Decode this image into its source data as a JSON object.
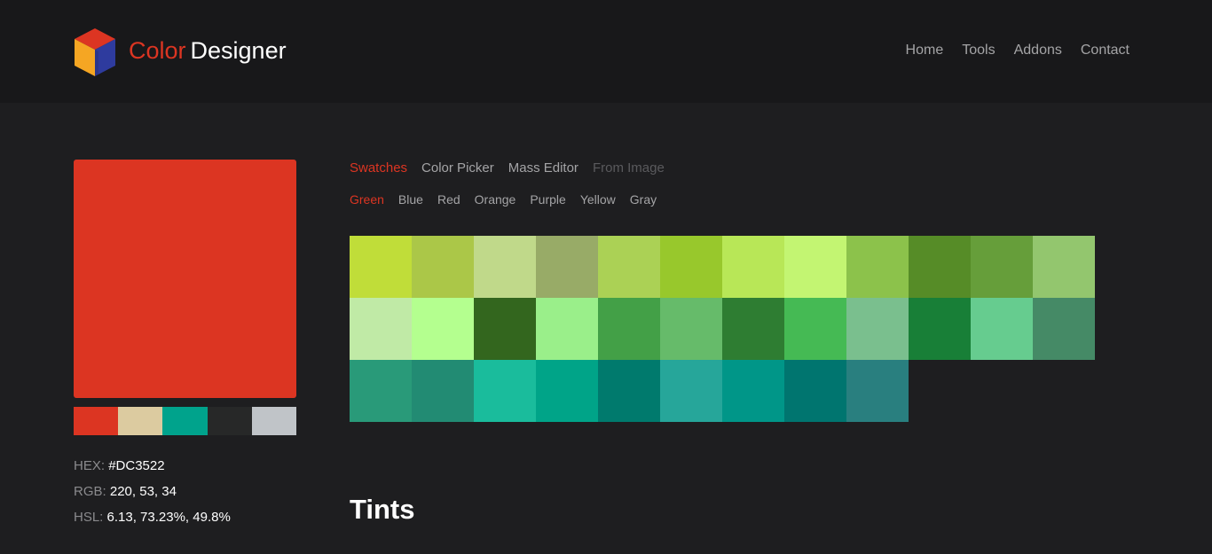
{
  "header": {
    "brand_part1": "Color",
    "brand_part2": "Designer",
    "nav": [
      "Home",
      "Tools",
      "Addons",
      "Contact"
    ]
  },
  "selected": {
    "color": "#DC3522",
    "palette": [
      "#DC3522",
      "#DCCBA0",
      "#00A38C",
      "#272828",
      "#C0C4C8"
    ],
    "hex_label": "HEX:",
    "hex_value": "#DC3522",
    "rgb_label": "RGB:",
    "rgb_value": "220, 53, 34",
    "hsl_label": "HSL:",
    "hsl_value": "6.13, 73.23%, 49.8%"
  },
  "tabs": [
    "Swatches",
    "Color Picker",
    "Mass Editor",
    "From Image"
  ],
  "subtabs": [
    "Green",
    "Blue",
    "Red",
    "Orange",
    "Purple",
    "Yellow",
    "Gray"
  ],
  "swatches": [
    "#C0DD39",
    "#ABC748",
    "#C0D98A",
    "#98AB67",
    "#ABD155",
    "#98C82C",
    "#B8E757",
    "#C3F572",
    "#8CC24B",
    "#568C27",
    "#669E3A",
    "#93C66E",
    "#C0EAA6",
    "#B4FF8F",
    "#33661E",
    "#9AEF8A",
    "#43A047",
    "#66BB6A",
    "#2E7D32",
    "#45BA54",
    "#7ABF8E",
    "#187F37",
    "#66CC8F",
    "#458A66",
    "#299A79",
    "#228B73",
    "#1ABC9C",
    "#00A488",
    "#007A6D",
    "#26A69A",
    "#009688",
    "#00756F",
    "#297F7F"
  ],
  "section_title": "Tints"
}
